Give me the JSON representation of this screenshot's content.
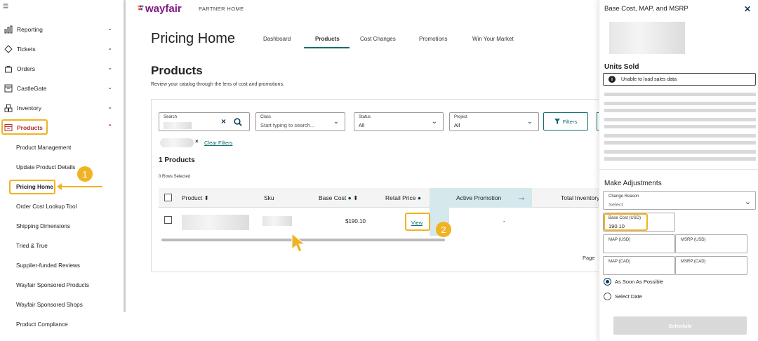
{
  "sidebar": {
    "items": [
      {
        "label": "Reporting",
        "icon": "bar-chart-icon"
      },
      {
        "label": "Tickets",
        "icon": "ticket-icon"
      },
      {
        "label": "Orders",
        "icon": "bag-icon"
      },
      {
        "label": "CastleGate",
        "icon": "warehouse-icon"
      },
      {
        "label": "Inventory",
        "icon": "boxes-icon"
      },
      {
        "label": "Products",
        "icon": "products-icon"
      }
    ],
    "subitems": [
      "Product Management",
      "Update Product Details",
      "Pricing Home",
      "Order Cost Lookup Tool",
      "Shipping Dimensions",
      "Tried & True",
      "Supplier-funded Reviews",
      "Wayfair Sponsored Products",
      "Wayfair Sponsored Shops",
      "Product Compliance"
    ]
  },
  "badges": {
    "one": "1",
    "two": "2"
  },
  "header": {
    "logo": "wayfair",
    "logo_sub": "PARTNER HOME"
  },
  "page": {
    "title": "Pricing Home",
    "tabs": [
      "Dashboard",
      "Products",
      "Cost Changes",
      "Promotions",
      "Win Your Market"
    ],
    "section_title": "Products",
    "section_sub": "Review your catalog through the lens of cost and promotions."
  },
  "filters": {
    "search_label": "Search",
    "class_label": "Class",
    "class_placeholder": "Start typing to search...",
    "status_label": "Status",
    "status_value": "All",
    "project_label": "Project",
    "project_value": "All",
    "filters_button": "Filters",
    "clear_filters": "Clear Filters"
  },
  "table": {
    "count": "1 Products",
    "rows_selected": "0 Rows Selected",
    "headers": {
      "product": "Product",
      "sku": "Sku",
      "base_cost": "Base Cost",
      "retail_price": "Retail Price",
      "active_promotion": "Active Promotion",
      "total_inventory": "Total Inventory"
    },
    "row": {
      "base_cost": "$190.10",
      "retail_price_link": "View",
      "active_promotion": "-"
    },
    "page_label": "Page"
  },
  "panel": {
    "title": "Base Cost, MAP, and MSRP",
    "units_sold": "Units Sold",
    "alert": "Unable to load sales data",
    "make_adjustments": "Make Adjustments",
    "change_reason_label": "Change Reason",
    "change_reason_value": "Select",
    "base_cost_label": "Base Cost (USD)",
    "base_cost_value": "190.10",
    "map_usd_label": "MAP (USD)",
    "msrp_usd_label": "MSRP (USD)",
    "map_cad_label": "MAP (CAD)",
    "msrp_cad_label": "MSRP (CAD)",
    "radio_asap": "As Soon As Possible",
    "radio_date": "Select Date",
    "schedule_button": "Schedule"
  },
  "colors": {
    "accent": "#0b6e6e",
    "highlight": "#f0b323",
    "brand": "#7f187f"
  }
}
